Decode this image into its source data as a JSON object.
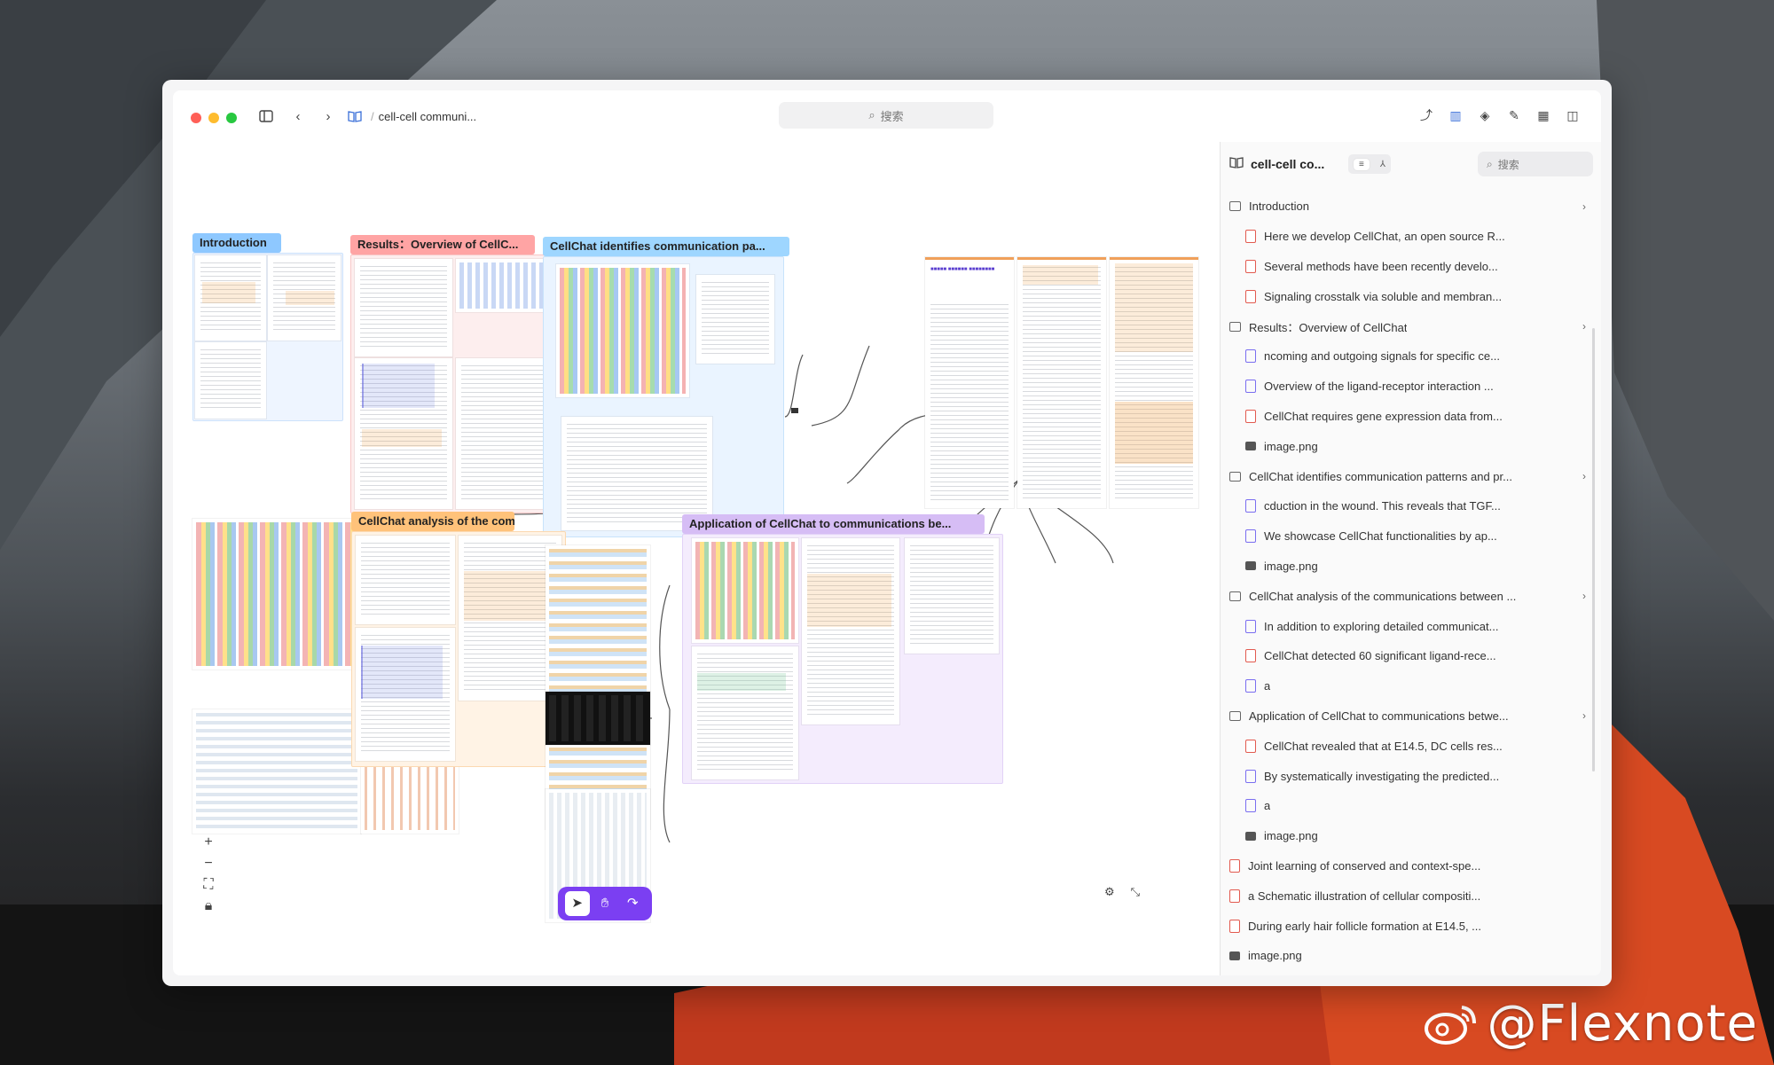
{
  "window": {
    "breadcrumb": "cell-cell communi...",
    "search_placeholder": "搜索"
  },
  "canvas": {
    "nodes": [
      {
        "title": "Introduction",
        "color": "#8ec8ff"
      },
      {
        "title": "Results：Overview of CellC...",
        "color": "#ffa4a4"
      },
      {
        "title": "CellChat identifies communication pa...",
        "color": "#9ed6ff"
      },
      {
        "title": "CellChat analysis of the com...",
        "color": "#ffc27a"
      },
      {
        "title": "Application of CellChat to communications be...",
        "color": "#d6bdf5"
      }
    ]
  },
  "sidebar": {
    "title": "cell-cell co...",
    "search_placeholder": "搜索",
    "items": [
      {
        "type": "group",
        "label": "Introduction",
        "chevron": true
      },
      {
        "type": "pdf",
        "label": "Here we develop CellChat, an open source R...",
        "indent": 1
      },
      {
        "type": "pdf",
        "label": "Several methods have been recently develo...",
        "indent": 1
      },
      {
        "type": "pdf",
        "label": "Signaling crosstalk via soluble and membran...",
        "indent": 1
      },
      {
        "type": "group",
        "label": "Results：Overview of CellChat",
        "chevron": true
      },
      {
        "type": "note",
        "label": "ncoming and outgoing signals for specific ce...",
        "indent": 1
      },
      {
        "type": "note",
        "label": "Overview of the ligand-receptor interaction ...",
        "indent": 1
      },
      {
        "type": "pdf",
        "label": "CellChat requires gene expression data from...",
        "indent": 1
      },
      {
        "type": "image",
        "label": "image.png",
        "indent": 1
      },
      {
        "type": "group",
        "label": "CellChat identifies communication patterns and pr...",
        "chevron": true
      },
      {
        "type": "note",
        "label": "cduction in the wound. This reveals that TGF...",
        "indent": 1
      },
      {
        "type": "note",
        "label": "We showcase CellChat functionalities by ap...",
        "indent": 1
      },
      {
        "type": "image",
        "label": "image.png",
        "indent": 1
      },
      {
        "type": "group",
        "label": "CellChat analysis of the communications between ...",
        "chevron": true
      },
      {
        "type": "note",
        "label": "In addition to exploring detailed communicat...",
        "indent": 1
      },
      {
        "type": "pdf",
        "label": "CellChat detected 60 significant ligand-rece...",
        "indent": 1
      },
      {
        "type": "note",
        "label": "a",
        "indent": 1
      },
      {
        "type": "group",
        "label": "Application of CellChat to communications betwe...",
        "chevron": true
      },
      {
        "type": "pdf",
        "label": "CellChat revealed that at E14.5, DC cells res...",
        "indent": 1
      },
      {
        "type": "note",
        "label": "By systematically investigating the predicted...",
        "indent": 1
      },
      {
        "type": "note",
        "label": "a",
        "indent": 1
      },
      {
        "type": "image",
        "label": "image.png",
        "indent": 1
      },
      {
        "type": "pdf",
        "label": "Joint learning of conserved and context-spe...",
        "indent": 0
      },
      {
        "type": "pdf",
        "label": "a Schematic illustration of cellular compositi...",
        "indent": 0
      },
      {
        "type": "pdf",
        "label": "During early hair follicle formation at E14.5, ...",
        "indent": 0
      },
      {
        "type": "image",
        "label": "image.png",
        "indent": 0
      }
    ]
  },
  "watermark": "@Flexnote",
  "colors": {
    "accent": "#7b3ff2",
    "traffic_red": "#ff5f57",
    "traffic_yellow": "#febc2e",
    "traffic_green": "#28c840"
  }
}
